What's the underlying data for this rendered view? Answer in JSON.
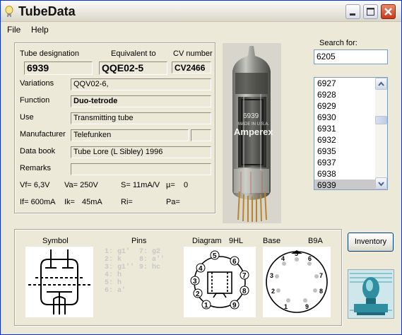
{
  "window": {
    "title": "TubeData"
  },
  "menu": {
    "file": "File",
    "help": "Help"
  },
  "labels": {
    "designation": "Tube designation",
    "equivalent": "Equivalent to",
    "cv": "CV number",
    "variations": "Variations",
    "function": "Function",
    "use": "Use",
    "manufacturer": "Manufacturer",
    "databook": "Data book",
    "remarks": "Remarks",
    "search_for": "Search for:",
    "symbol": "Symbol",
    "pins": "Pins",
    "diagram": "Diagram",
    "diagram_code": "9HL",
    "base": "Base",
    "base_code": "B9A"
  },
  "values": {
    "designation": "6939",
    "equivalent": "QQE02-5",
    "cv": "CV2466",
    "variations": "QQV02-6,",
    "function": "Duo-tetrode",
    "use": "Transmitting tube",
    "manufacturer": "Telefunken",
    "databook": "Tube Lore (L Sibley) 1996",
    "remarks": ""
  },
  "params": {
    "vf": "Vf= 6,3V",
    "va": "Va= 250V",
    "s": "S= 11mA/V",
    "mu": "µ=",
    "mu_val": "0",
    "if": "If= 600mA",
    "ik": "Ik=",
    "ik_val": "45mA",
    "ri": "Ri=",
    "pa": "Pa="
  },
  "search": {
    "value": "6205"
  },
  "list": {
    "items": [
      "6927",
      "6928",
      "6929",
      "6930",
      "6931",
      "6932",
      "6935",
      "6937",
      "6938",
      "6939"
    ],
    "selected": "6939"
  },
  "pins": [
    "1: g1'",
    "2: k",
    "3: g1''",
    "4: h",
    "5: h",
    "6: a'",
    "7: g2",
    "8: a''",
    "9: hc"
  ],
  "photo": {
    "print1": "6939",
    "print2": "MADE IN U.S.A.",
    "brand": "Amperex"
  },
  "buttons": {
    "inventory": "Inventory"
  }
}
